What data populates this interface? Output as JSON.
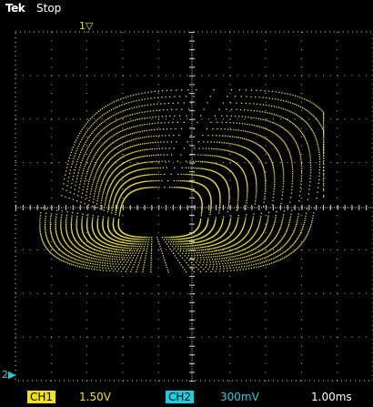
{
  "header": {
    "brand": "Tek",
    "status": "Stop"
  },
  "trigger_marker": {
    "label": "1▽"
  },
  "ch2_marker": {
    "label": "2▶"
  },
  "footer": {
    "ch1_tag": "CH1",
    "ch1_scale": "1.50V",
    "ch2_tag": "CH2",
    "ch2_scale": "300mV",
    "timebase": "1.00ms"
  },
  "colors": {
    "trace": "#e6e040",
    "ch1": "#f2e30a",
    "ch2": "#18d0e0",
    "grid": "#ffffff"
  }
}
